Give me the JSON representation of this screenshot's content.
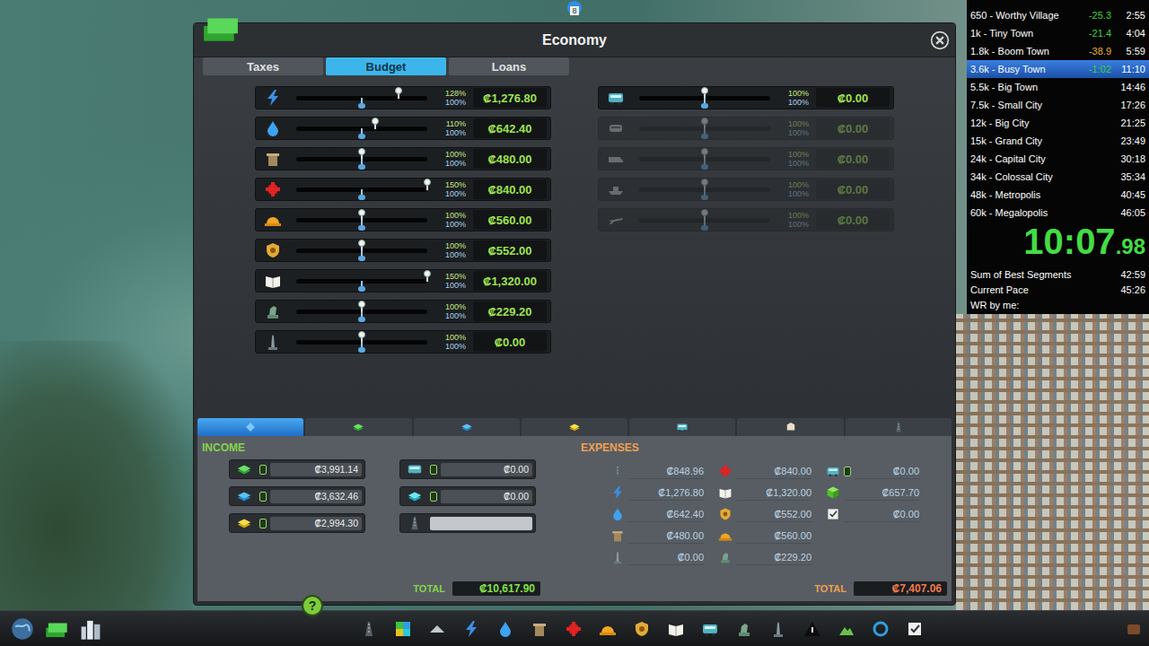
{
  "window": {
    "title": "Economy"
  },
  "map_marker": {
    "label": "8"
  },
  "tabs": [
    {
      "label": "Taxes",
      "selected": false
    },
    {
      "label": "Budget",
      "selected": true
    },
    {
      "label": "Loans",
      "selected": false
    }
  ],
  "budget": {
    "services": [
      {
        "icon": "electricity",
        "day": "128%",
        "night": "100%",
        "level": 0.78,
        "night_level": 0.5,
        "amount": "₡1,276.80",
        "disabled": false
      },
      {
        "icon": "water",
        "day": "110%",
        "night": "100%",
        "level": 0.6,
        "night_level": 0.5,
        "amount": "₡642.40",
        "disabled": false
      },
      {
        "icon": "garbage",
        "day": "100%",
        "night": "100%",
        "level": 0.5,
        "night_level": 0.5,
        "amount": "₡480.00",
        "disabled": false
      },
      {
        "icon": "health",
        "day": "150%",
        "night": "100%",
        "level": 1.0,
        "night_level": 0.5,
        "amount": "₡840.00",
        "disabled": false
      },
      {
        "icon": "fire",
        "day": "100%",
        "night": "100%",
        "level": 0.5,
        "night_level": 0.5,
        "amount": "₡560.00",
        "disabled": false
      },
      {
        "icon": "police",
        "day": "100%",
        "night": "100%",
        "level": 0.5,
        "night_level": 0.5,
        "amount": "₡552.00",
        "disabled": false
      },
      {
        "icon": "education",
        "day": "150%",
        "night": "100%",
        "level": 1.0,
        "night_level": 0.5,
        "amount": "₡1,320.00",
        "disabled": false
      },
      {
        "icon": "parks",
        "day": "100%",
        "night": "100%",
        "level": 0.5,
        "night_level": 0.5,
        "amount": "₡229.20",
        "disabled": false
      },
      {
        "icon": "monument",
        "day": "100%",
        "night": "100%",
        "level": 0.5,
        "night_level": 0.5,
        "amount": "₡0.00",
        "disabled": false
      }
    ],
    "transport": [
      {
        "icon": "bus",
        "day": "100%",
        "night": "100%",
        "level": 0.5,
        "night_level": 0.5,
        "amount": "₡0.00",
        "disabled": false
      },
      {
        "icon": "metro",
        "day": "100%",
        "night": "100%",
        "level": 0.5,
        "night_level": 0.5,
        "amount": "₡0.00",
        "disabled": true
      },
      {
        "icon": "train",
        "day": "100%",
        "night": "100%",
        "level": 0.5,
        "night_level": 0.5,
        "amount": "₡0.00",
        "disabled": true
      },
      {
        "icon": "ship",
        "day": "100%",
        "night": "100%",
        "level": 0.5,
        "night_level": 0.5,
        "amount": "₡0.00",
        "disabled": true
      },
      {
        "icon": "plane",
        "day": "100%",
        "night": "100%",
        "level": 0.5,
        "night_level": 0.5,
        "amount": "₡0.00",
        "disabled": true
      }
    ]
  },
  "lower_tabs": [
    {
      "icon": "overview",
      "selected": true
    },
    {
      "icon": "residential",
      "selected": false
    },
    {
      "icon": "commercial",
      "selected": false
    },
    {
      "icon": "industrial",
      "selected": false
    },
    {
      "icon": "bus",
      "selected": false
    },
    {
      "icon": "tourism",
      "selected": false
    },
    {
      "icon": "road",
      "selected": false
    }
  ],
  "income": {
    "label": "INCOME",
    "items": [
      {
        "icon": "residential",
        "toggle": true,
        "amount": "₡3,991.14"
      },
      {
        "icon": "commercial",
        "toggle": true,
        "amount": "₡3,632.46"
      },
      {
        "icon": "industrial",
        "toggle": true,
        "amount": "₡2,994.30"
      },
      {
        "icon": "bus",
        "toggle": true,
        "amount": "₡0.00"
      },
      {
        "icon": "office",
        "toggle": true,
        "amount": "₡0.00"
      },
      {
        "icon": "road",
        "toggle": false,
        "amount": ""
      }
    ],
    "total_label": "TOTAL",
    "total": "₡10,617.90"
  },
  "expenses": {
    "label": "EXPENSES",
    "items": [
      {
        "icon": "road",
        "toggle": false,
        "amount": "₡848.96"
      },
      {
        "icon": "electricity",
        "toggle": false,
        "amount": "₡1,276.80"
      },
      {
        "icon": "water",
        "toggle": false,
        "amount": "₡642.40"
      },
      {
        "icon": "garbage",
        "toggle": false,
        "amount": "₡480.00"
      },
      {
        "icon": "monument",
        "toggle": false,
        "amount": "₡0.00"
      },
      {
        "icon": "health",
        "toggle": false,
        "amount": "₡840.00"
      },
      {
        "icon": "education",
        "toggle": false,
        "amount": "₡1,320.00"
      },
      {
        "icon": "police",
        "toggle": false,
        "amount": "₡552.00"
      },
      {
        "icon": "fire",
        "toggle": false,
        "amount": "₡560.00"
      },
      {
        "icon": "parks",
        "toggle": false,
        "amount": "₡229.20"
      },
      {
        "icon": "bus",
        "toggle": true,
        "amount": "₡0.00"
      },
      {
        "icon": "policy",
        "toggle": false,
        "amount": "₡657.70"
      },
      {
        "icon": "check",
        "toggle": false,
        "amount": "₡0.00"
      }
    ],
    "total_label": "TOTAL",
    "total": "₡7,407.06"
  },
  "help_button": "?",
  "splits": {
    "rows": [
      {
        "name": "650 - Worthy Village",
        "delta": "-25.3",
        "color": "#3fd13f",
        "time": "2:55",
        "selected": false
      },
      {
        "name": "1k - Tiny Town",
        "delta": "-21.4",
        "color": "#3fd13f",
        "time": "4:04",
        "selected": false
      },
      {
        "name": "1.8k - Boom Town",
        "delta": "-38.9",
        "color": "#e8b23a",
        "time": "5:59",
        "selected": false
      },
      {
        "name": "3.6k - Busy Town",
        "delta": "-1:02",
        "color": "#3fd13f",
        "time": "11:10",
        "selected": true
      },
      {
        "name": "5.5k - Big Town",
        "delta": "",
        "color": "#ffffff",
        "time": "14:46",
        "selected": false
      },
      {
        "name": "7.5k - Small City",
        "delta": "",
        "color": "#ffffff",
        "time": "17:26",
        "selected": false
      },
      {
        "name": "12k - Big City",
        "delta": "",
        "color": "#ffffff",
        "time": "21:25",
        "selected": false
      },
      {
        "name": "15k - Grand City",
        "delta": "",
        "color": "#ffffff",
        "time": "23:49",
        "selected": false
      },
      {
        "name": "24k - Capital City",
        "delta": "",
        "color": "#ffffff",
        "time": "30:18",
        "selected": false
      },
      {
        "name": "34k - Colossal City",
        "delta": "",
        "color": "#ffffff",
        "time": "35:34",
        "selected": false
      },
      {
        "name": "48k - Metropolis",
        "delta": "",
        "color": "#ffffff",
        "time": "40:45",
        "selected": false
      },
      {
        "name": "60k - Megalopolis",
        "delta": "",
        "color": "#ffffff",
        "time": "46:05",
        "selected": false
      }
    ],
    "timer": {
      "main": "10:07",
      "fraction": ".98"
    },
    "info": [
      {
        "label": "Sum of Best Segments",
        "value": "42:59"
      },
      {
        "label": "Current Pace",
        "value": "45:26"
      },
      {
        "label": "WR by me:",
        "value": ""
      }
    ]
  },
  "toolbar": {
    "left": [
      {
        "icon": "globe"
      },
      {
        "icon": "money"
      },
      {
        "icon": "skyline"
      }
    ],
    "center": [
      {
        "icon": "road"
      },
      {
        "icon": "zoning"
      },
      {
        "icon": "districts"
      },
      {
        "icon": "electricity"
      },
      {
        "icon": "water"
      },
      {
        "icon": "garbage"
      },
      {
        "icon": "health"
      },
      {
        "icon": "fire"
      },
      {
        "icon": "police"
      },
      {
        "icon": "education"
      },
      {
        "icon": "bus"
      },
      {
        "icon": "parks"
      },
      {
        "icon": "monument"
      },
      {
        "icon": "disasters"
      },
      {
        "icon": "landscaping"
      },
      {
        "icon": "ring"
      },
      {
        "icon": "check"
      }
    ],
    "right": [
      {
        "icon": "settings"
      }
    ]
  }
}
